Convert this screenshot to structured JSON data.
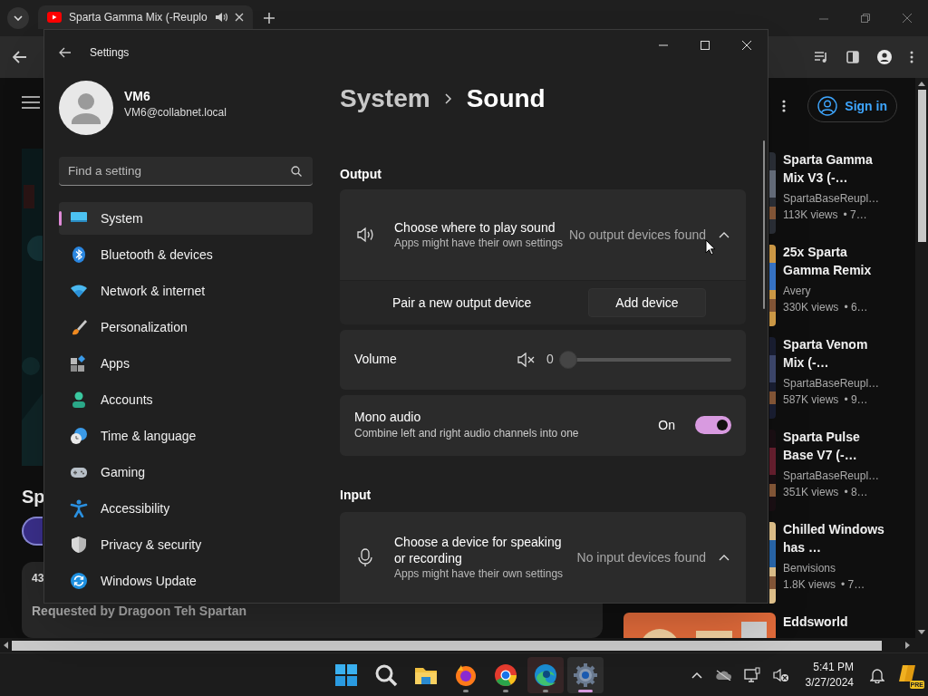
{
  "browser": {
    "tab": {
      "title": "Sparta Gamma Mix (-Reuplo",
      "audio_playing": true
    },
    "page": {
      "video_title": "Sp",
      "description_count": "43",
      "description": "Requested by Dragoon Teh Spartan",
      "sign_in": "Sign in",
      "related": [
        {
          "title": "Sparta Gamma Mix V3 (-…",
          "channel": "SpartaBaseReupl…",
          "views": "113K views",
          "age": "• 7…"
        },
        {
          "title": "25x Sparta Gamma Remix",
          "channel": "Avery",
          "views": "330K views",
          "age": "• 6…"
        },
        {
          "title": "Sparta Venom Mix (-…",
          "channel": "SpartaBaseReupl…",
          "views": "587K views",
          "age": "• 9…"
        },
        {
          "title": "Sparta Pulse Base V7 (-…",
          "channel": "SpartaBaseReupl…",
          "views": "351K views",
          "age": "• 8…"
        },
        {
          "title": "Chilled Windows has …",
          "channel": "Benvisions",
          "views": "1.8K views",
          "age": "• 7…"
        },
        {
          "title": "Eddsworld"
        }
      ]
    }
  },
  "settings": {
    "title": "Settings",
    "user": {
      "name": "VM6",
      "email": "VM6@collabnet.local"
    },
    "search": {
      "placeholder": "Find a setting"
    },
    "nav": [
      {
        "label": "System",
        "kind": "system",
        "selected": true
      },
      {
        "label": "Bluetooth & devices",
        "kind": "bluetooth",
        "selected": false
      },
      {
        "label": "Network & internet",
        "kind": "network",
        "selected": false
      },
      {
        "label": "Personalization",
        "kind": "brush",
        "selected": false
      },
      {
        "label": "Apps",
        "kind": "apps",
        "selected": false
      },
      {
        "label": "Accounts",
        "kind": "accounts",
        "selected": false
      },
      {
        "label": "Time & language",
        "kind": "time",
        "selected": false
      },
      {
        "label": "Gaming",
        "kind": "gaming",
        "selected": false
      },
      {
        "label": "Accessibility",
        "kind": "accessibility",
        "selected": false
      },
      {
        "label": "Privacy & security",
        "kind": "privacy",
        "selected": false
      },
      {
        "label": "Windows Update",
        "kind": "update",
        "selected": false
      }
    ],
    "breadcrumb": {
      "parent": "System",
      "current": "Sound"
    },
    "output": {
      "heading": "Output",
      "device": {
        "title": "Choose where to play sound",
        "subtitle": "Apps might have their own settings",
        "value": "No output devices found",
        "expanded": true
      },
      "pair": {
        "label": "Pair a new output device",
        "button": "Add device"
      },
      "volume": {
        "label": "Volume",
        "muted": true,
        "reading": "0",
        "level": 0
      },
      "mono": {
        "title": "Mono audio",
        "subtitle": "Combine left and right audio channels into one",
        "state_label": "On",
        "on": true
      }
    },
    "input": {
      "heading": "Input",
      "device": {
        "title": "Choose a device for speaking or recording",
        "subtitle": "Apps might have their own settings",
        "value": "No input devices found",
        "expanded": true
      }
    }
  },
  "taskbar": {
    "apps": [
      {
        "kind": "start",
        "running": false,
        "selected": false
      },
      {
        "kind": "search",
        "running": false,
        "selected": false
      },
      {
        "kind": "explorer",
        "running": false,
        "selected": false
      },
      {
        "kind": "firefox",
        "running": true,
        "selected": false
      },
      {
        "kind": "chrome",
        "running": true,
        "selected": false
      },
      {
        "kind": "edge",
        "running": true,
        "selected": false
      },
      {
        "kind": "settings",
        "running": true,
        "selected": true
      }
    ],
    "time": "5:41 PM",
    "date": "3/27/2024",
    "copilot_badge": "PRE"
  }
}
